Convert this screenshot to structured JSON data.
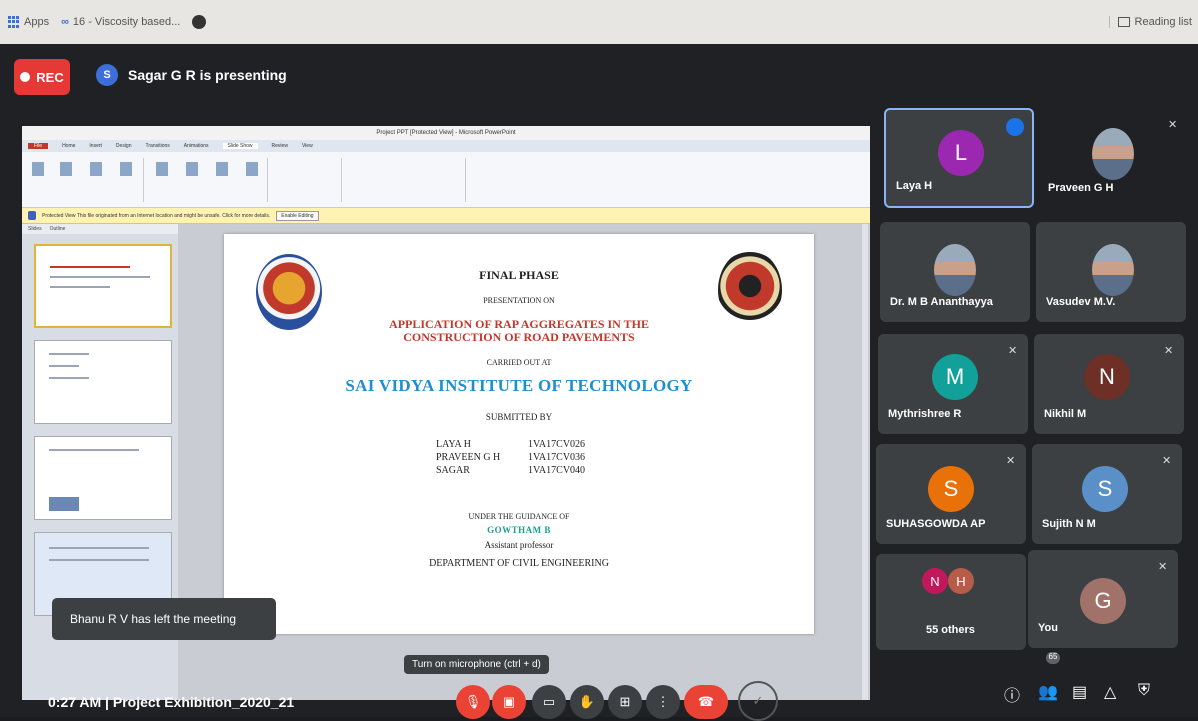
{
  "browser": {
    "apps_label": "Apps",
    "bookmark_1": "16 - Viscosity based...",
    "reading_list": "Reading list"
  },
  "meet": {
    "rec_label": "REC",
    "presenter_initial": "S",
    "presenter_text": "Sagar G R is presenting",
    "toast": "Bhanu R V has left the meeting",
    "tooltip": "Turn on microphone (ctrl + d)",
    "meeting_time_title": "0:27 AM  |  Project Exhibition_2020_21",
    "participant_badge": "65"
  },
  "ppt": {
    "window_title": "Project PPT [Protected View] - Microsoft PowerPoint",
    "tabs": [
      "File",
      "Home",
      "Insert",
      "Design",
      "Transitions",
      "Animations",
      "Slide Show",
      "Review",
      "View"
    ],
    "protected_text": "Protected View  This file originated from an Internet location and might be unsafe. Click for more details.",
    "enable_editing": "Enable Editing",
    "thumb_tabs": [
      "Slides",
      "Outline"
    ]
  },
  "slide": {
    "title": "FINAL PHASE",
    "presentation_on": "PRESENTATION ON",
    "project_line1": "APPLICATION OF RAP AGGREGATES IN THE",
    "project_line2": "CONSTRUCTION  OF ROAD PAVEMENTS",
    "carried_out": "CARRIED OUT AT",
    "institute": "SAI VIDYA INSTITUTE OF TECHNOLOGY",
    "submitted_by": "SUBMITTED  BY",
    "members": [
      {
        "name": "LAYA H",
        "usn": "1VA17CV026"
      },
      {
        "name": "PRAVEEN G H",
        "usn": "1VA17CV036"
      },
      {
        "name": "SAGAR",
        "usn": "1VA17CV040"
      }
    ],
    "guidance": "UNDER THE GUIDANCE OF",
    "guide": "GOWTHAM  B",
    "designation": "Assistant professor",
    "department": "DEPARTMENT  OF CIVIL ENGINEERING"
  },
  "participants": [
    {
      "name": "Laya H",
      "initial": "L",
      "color": "#9c27b0"
    },
    {
      "name": "Praveen G H"
    },
    {
      "name": "Dr. M B Ananthayya"
    },
    {
      "name": "Vasudev M.V."
    },
    {
      "name": "Mythrishree R",
      "initial": "M",
      "color": "#12a19a"
    },
    {
      "name": "Nikhil M",
      "initial": "N",
      "color": "#6d2f26"
    },
    {
      "name": "SUHASGOWDA AP",
      "initial": "S",
      "color": "#e8710a"
    },
    {
      "name": "Sujith N M",
      "initial": "S",
      "color": "#5b8fc7"
    },
    {
      "name": "55 others",
      "initials": [
        "N",
        "H"
      ]
    },
    {
      "name": "You",
      "initial": "G",
      "color": "#a0726a"
    }
  ]
}
